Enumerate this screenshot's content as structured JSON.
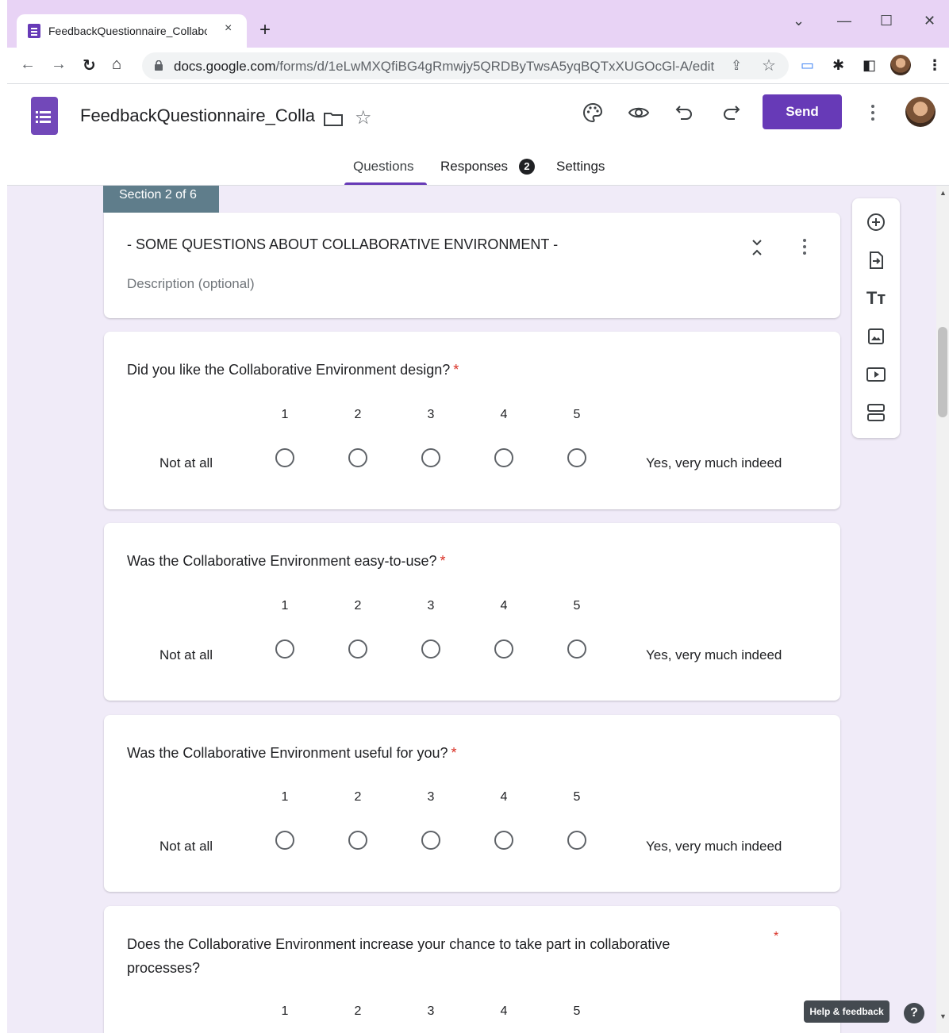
{
  "browser": {
    "tab_title": "FeedbackQuestionnaire_Collabor",
    "tab_close": "×",
    "new_tab": "+",
    "url_host": "docs.google.com",
    "url_path": "/forms/d/1eLwMXQfiBG4gRmwjy5QRDByTwsA5yqBQTxXUGOcGl-A/edit"
  },
  "forms_header": {
    "doc_title": "FeedbackQuestionnaire_Colla",
    "send_label": "Send",
    "tabs": [
      {
        "label": "Questions"
      },
      {
        "label": "Responses"
      },
      {
        "label": "Settings"
      }
    ],
    "responses_count": "2"
  },
  "section": {
    "tag": "Section 2 of 6",
    "title": "- SOME QUESTIONS ABOUT COLLABORATIVE ENVIRONMENT -",
    "description_placeholder": "Description (optional)"
  },
  "scale": {
    "numbers": [
      "1",
      "2",
      "3",
      "4",
      "5"
    ],
    "low_label": "Not at all",
    "high_label": "Yes, very much indeed"
  },
  "questions": [
    {
      "title": "Did you like the Collaborative Environment design?",
      "required_mark": "*"
    },
    {
      "title": "Was the Collaborative Environment easy-to-use?",
      "required_mark": "*"
    },
    {
      "title": "Was the Collaborative Environment useful for you?",
      "required_mark": "*"
    },
    {
      "title": "Does the Collaborative Environment increase your chance to take part in collaborative processes?",
      "required_mark": "*"
    }
  ],
  "footer": {
    "help_feedback": "Help & feedback",
    "help_icon": "?"
  },
  "colors": {
    "accent": "#673ab7",
    "background": "#f0ebf8",
    "section_tag": "#5f7d8b",
    "required": "#d93025"
  }
}
